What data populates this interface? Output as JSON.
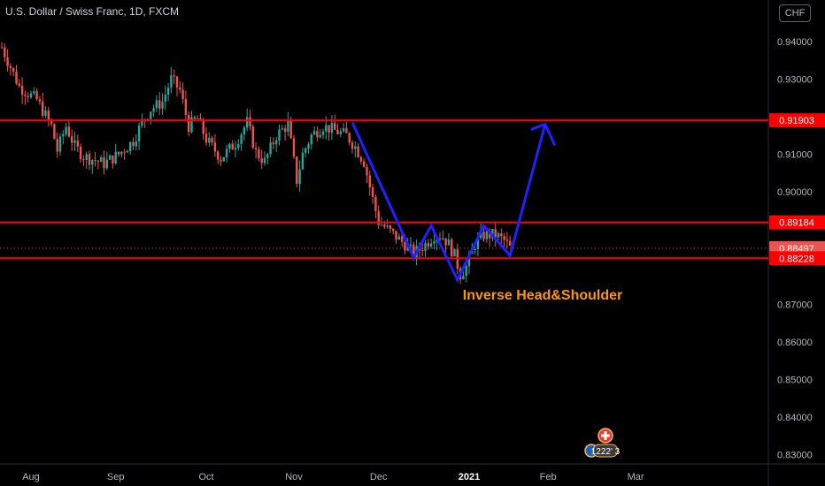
{
  "header": {
    "symbol_title": "U.S. Dollar / Swiss Franc, 1D, FXCM",
    "currency_badge": "CHF"
  },
  "colors": {
    "up": "#26a69a",
    "down": "#ef5350",
    "level_line": "#ff0000",
    "pattern": "#1e22ff",
    "annotation": "#ff9800",
    "axis_text": "#b2b5be"
  },
  "chart_data": {
    "type": "candlestick",
    "title": "U.S. Dollar / Swiss Franc, 1D, FXCM",
    "y_axis_side": "right",
    "ylim": [
      0.8275,
      0.9445
    ],
    "x_labels": [
      "Aug",
      "Sep",
      "Oct",
      "Nov",
      "Dec",
      "2021",
      "Feb",
      "Mar"
    ],
    "y_ticks": [
      "0.94000",
      "0.93000",
      "0.91000",
      "0.90000",
      "0.87000",
      "0.86000",
      "0.85000",
      "0.84000",
      "0.83000"
    ],
    "y_tick_values": [
      0.94,
      0.93,
      0.91,
      0.9,
      0.87,
      0.86,
      0.85,
      0.84,
      0.83
    ],
    "price_labels": [
      {
        "label": "0.91903",
        "value": 0.91903,
        "color": "#ff0000",
        "kind": "level"
      },
      {
        "label": "0.89184",
        "value": 0.89184,
        "color": "#ff0000",
        "kind": "level"
      },
      {
        "label": "0.88497",
        "value": 0.88497,
        "color": "#ef5350",
        "kind": "last"
      },
      {
        "label": "0.88228",
        "value": 0.88228,
        "color": "#ff0000",
        "kind": "level"
      }
    ],
    "horizontal_levels": [
      0.91903,
      0.89184,
      0.88228
    ],
    "last_price": 0.88497,
    "annotation": "Inverse Head&Shoulder",
    "candle_path": [
      [
        0,
        0.9385
      ],
      [
        6,
        0.928
      ],
      [
        12,
        0.9245
      ],
      [
        17,
        0.9175
      ],
      [
        19,
        0.911
      ],
      [
        22,
        0.9175
      ],
      [
        25,
        0.912
      ],
      [
        28,
        0.9095
      ],
      [
        35,
        0.9075
      ],
      [
        40,
        0.91
      ],
      [
        45,
        0.9135
      ],
      [
        48,
        0.9185
      ],
      [
        51,
        0.922
      ],
      [
        55,
        0.924
      ],
      [
        58,
        0.93
      ],
      [
        61,
        0.927
      ],
      [
        64,
        0.9175
      ],
      [
        67,
        0.9195
      ],
      [
        70,
        0.914
      ],
      [
        75,
        0.909
      ],
      [
        80,
        0.913
      ],
      [
        84,
        0.9185
      ],
      [
        87,
        0.9105
      ],
      [
        90,
        0.908
      ],
      [
        94,
        0.915
      ],
      [
        98,
        0.918
      ],
      [
        101,
        0.903
      ],
      [
        103,
        0.91
      ],
      [
        106,
        0.915
      ],
      [
        110,
        0.9175
      ],
      [
        115,
        0.916
      ],
      [
        118,
        0.915
      ],
      [
        121,
        0.912
      ],
      [
        124,
        0.908
      ],
      [
        127,
        0.898
      ],
      [
        129,
        0.892
      ],
      [
        132,
        0.89
      ],
      [
        135,
        0.888
      ],
      [
        138,
        0.886
      ],
      [
        141,
        0.8835
      ],
      [
        145,
        0.886
      ],
      [
        148,
        0.8885
      ],
      [
        151,
        0.888
      ],
      [
        153,
        0.886
      ],
      [
        155,
        0.883
      ],
      [
        157,
        0.878
      ],
      [
        159,
        0.88
      ],
      [
        162,
        0.886
      ],
      [
        165,
        0.8885
      ],
      [
        169,
        0.8885
      ],
      [
        172,
        0.887
      ],
      [
        174,
        0.885
      ]
    ],
    "pattern_path_points": [
      {
        "bar": 120,
        "price": 0.9185
      },
      {
        "bar": 141,
        "price": 0.8825
      },
      {
        "bar": 147,
        "price": 0.891
      },
      {
        "bar": 156,
        "price": 0.8765
      },
      {
        "bar": 165,
        "price": 0.891
      },
      {
        "bar": 174,
        "price": 0.883
      },
      {
        "bar": 186,
        "price": 0.918
      }
    ],
    "x_label_bars": [
      10,
      39,
      70,
      100,
      129,
      160,
      187,
      217
    ]
  },
  "widgets": {
    "events_icons": [
      "swiss-flag-icon",
      "us-flag-icon"
    ],
    "events_text": "1222' 3"
  }
}
